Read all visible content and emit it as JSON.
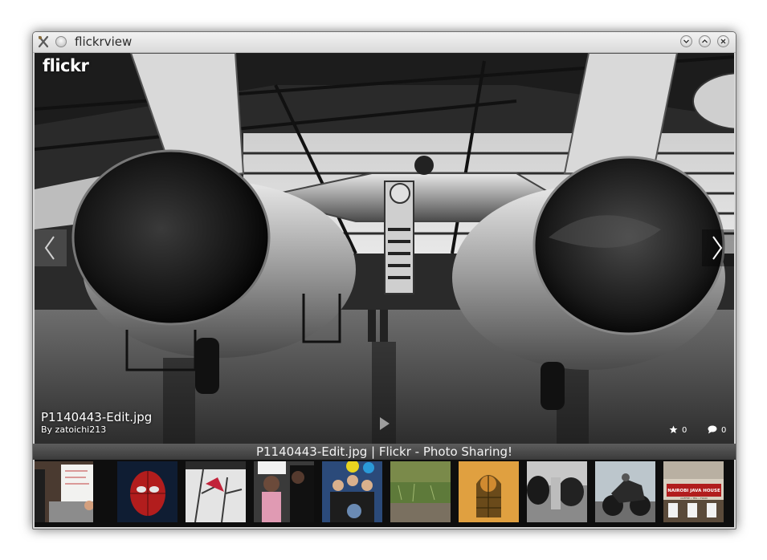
{
  "window": {
    "title": "flickrview",
    "controls": [
      "minimize",
      "maximize",
      "close"
    ]
  },
  "viewer": {
    "logo": "flickr",
    "photo_filename": "P1140443-Edit.jpg",
    "author_line": "By zatoichi213",
    "favorites_count": "0",
    "comments_count": "0"
  },
  "status": {
    "page_title": "P1140443-Edit.jpg | Flickr - Photo Sharing!"
  },
  "thumbnails": [
    {
      "name": "whiteboard-meeting"
    },
    {
      "name": "spider-man"
    },
    {
      "name": "winter-tree-card"
    },
    {
      "name": "child-party"
    },
    {
      "name": "family-balloons"
    },
    {
      "name": "grass-patch"
    },
    {
      "name": "wooden-window"
    },
    {
      "name": "jet-engines"
    },
    {
      "name": "motorcycle"
    },
    {
      "name": "nairobi-java-house"
    }
  ],
  "thumbnail_text": {
    "shop_sign": "NAIROBI JAVA HOUSE",
    "shop_sub": "COFFEE • TEA • FOOD"
  }
}
